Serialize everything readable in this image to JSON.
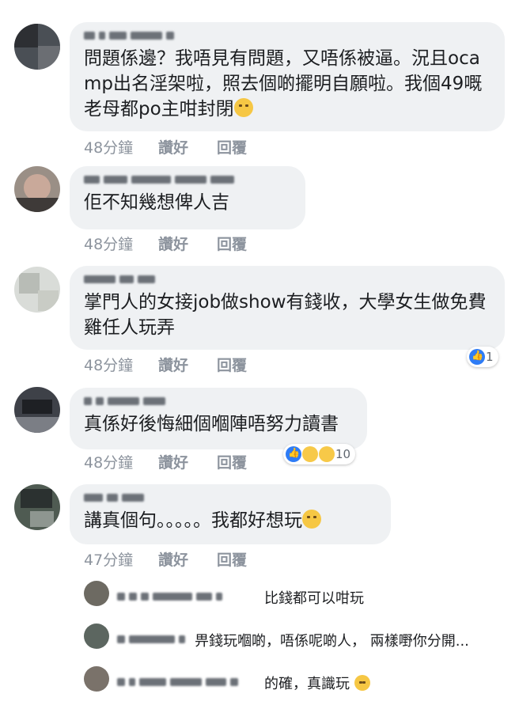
{
  "comments": [
    {
      "text": "問題係邊？我唔見有問題，又唔係被逼。況且ocamp出名淫架啦，照去個啲擺明自願啦。我個49嘅老母都po主咁封閉",
      "time": "48分鐘",
      "like": "讚好",
      "reply": "回覆",
      "emoji": "eye-roll-emoji"
    },
    {
      "text": "佢不知幾想俾人吉",
      "time": "48分鐘",
      "like": "讚好",
      "reply": "回覆"
    },
    {
      "text": "掌門人的女接job做show有錢收，大學女生做免費雞任人玩弄",
      "time": "48分鐘",
      "like": "讚好",
      "reply": "回覆",
      "reaction_count": "1"
    },
    {
      "text": "真係好後悔細個嗰陣唔努力讀書",
      "time": "48分鐘",
      "like": "讚好",
      "reply": "回覆",
      "reaction_count": "10"
    },
    {
      "text": "講真個句。。。。。我都好想玩",
      "time": "47分鐘",
      "like": "讚好",
      "reply": "回覆",
      "emoji": "expressionless-emoji"
    }
  ],
  "replies": [
    {
      "text": "比錢都可以咁玩"
    },
    {
      "text": "畀錢玩嗰啲，唔係呢啲人， 兩樣嘢你分開..."
    },
    {
      "text": "的確，真識玩",
      "emoji": "laugh-cry-emoji"
    }
  ],
  "colors": {
    "bubble": "#eff1f3",
    "meta": "#8d949e",
    "like_blue": "#2e7cf6",
    "emoji_yellow": "#f6c744"
  }
}
